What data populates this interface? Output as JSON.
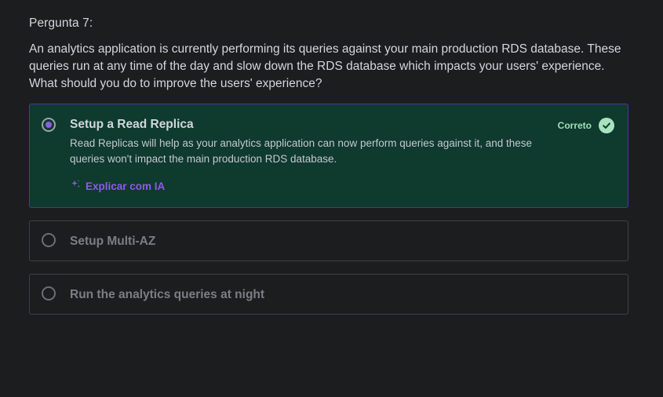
{
  "question": {
    "label": "Pergunta 7:",
    "text": "An analytics application is currently performing its queries against your main production RDS database. These queries run at any time of the day and slow down the RDS database which impacts your users' experience. What should you do to improve the users' experience?"
  },
  "answers": [
    {
      "title": "Setup a Read Replica",
      "selected": true,
      "status": "Correto",
      "explanation": "Read Replicas will help as your analytics application can now perform queries against it, and these queries won't impact the main production RDS database.",
      "ai_link": "Explicar com IA"
    },
    {
      "title": "Setup Multi-AZ",
      "selected": false
    },
    {
      "title": "Run the analytics queries at night",
      "selected": false
    }
  ],
  "colors": {
    "background": "#1c1d1f",
    "selected_background": "#0f3a2e",
    "selected_border": "#5a2bb5",
    "accent_purple": "#8e5ae8",
    "correct_green": "#a8e2bf"
  },
  "icons": {
    "correct": "check-circle-icon",
    "ai": "sparkle-icon"
  }
}
